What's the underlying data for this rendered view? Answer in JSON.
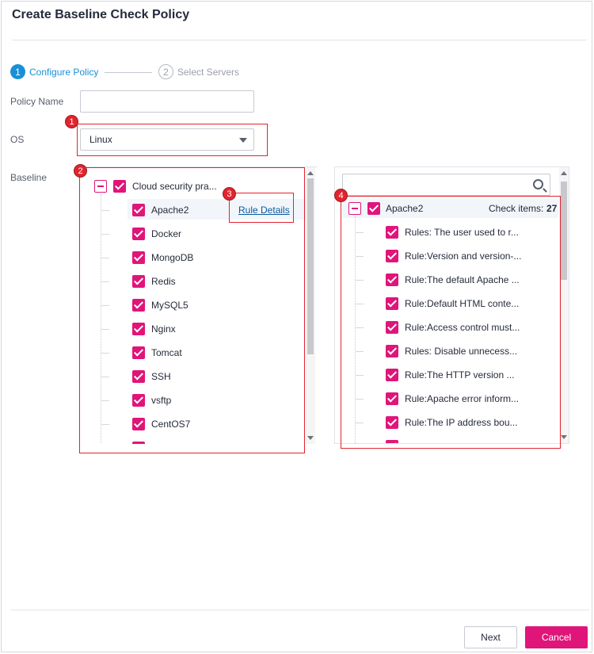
{
  "dialog": {
    "title": "Create Baseline Check Policy"
  },
  "steps": [
    {
      "number": "1",
      "label": "Configure Policy"
    },
    {
      "number": "2",
      "label": "Select Servers"
    }
  ],
  "form": {
    "policy_name_label": "Policy Name",
    "policy_name_value": "",
    "os_label": "OS",
    "os_value": "Linux",
    "baseline_label": "Baseline"
  },
  "callouts": [
    "1",
    "2",
    "3",
    "4"
  ],
  "baseline_tree": {
    "root_label": "Cloud security pra...",
    "rule_details_link": "Rule Details",
    "items": [
      "Apache2",
      "Docker",
      "MongoDB",
      "Redis",
      "MySQL5",
      "Nginx",
      "Tomcat",
      "SSH",
      "vsftp",
      "CentOS7"
    ]
  },
  "rules_panel": {
    "search_placeholder": "",
    "group_label": "Apache2",
    "check_items_label": "Check items:",
    "check_items_count": "27",
    "rules": [
      "Rules: The user used to r...",
      "Rule:Version and version-...",
      "Rule:The default Apache ...",
      "Rule:Default HTML conte...",
      "Rule:Access control must...",
      "Rules: Disable unnecess...",
      "Rule:The HTTP version ...",
      "Rule:Apache error inform...",
      "Rule:The IP address bou..."
    ]
  },
  "footer": {
    "next_label": "Next",
    "cancel_label": "Cancel"
  },
  "colors": {
    "accent": "#e0157a",
    "step_active": "#1a8fd6",
    "callout": "#e2242e",
    "link": "#0b5a9c"
  }
}
